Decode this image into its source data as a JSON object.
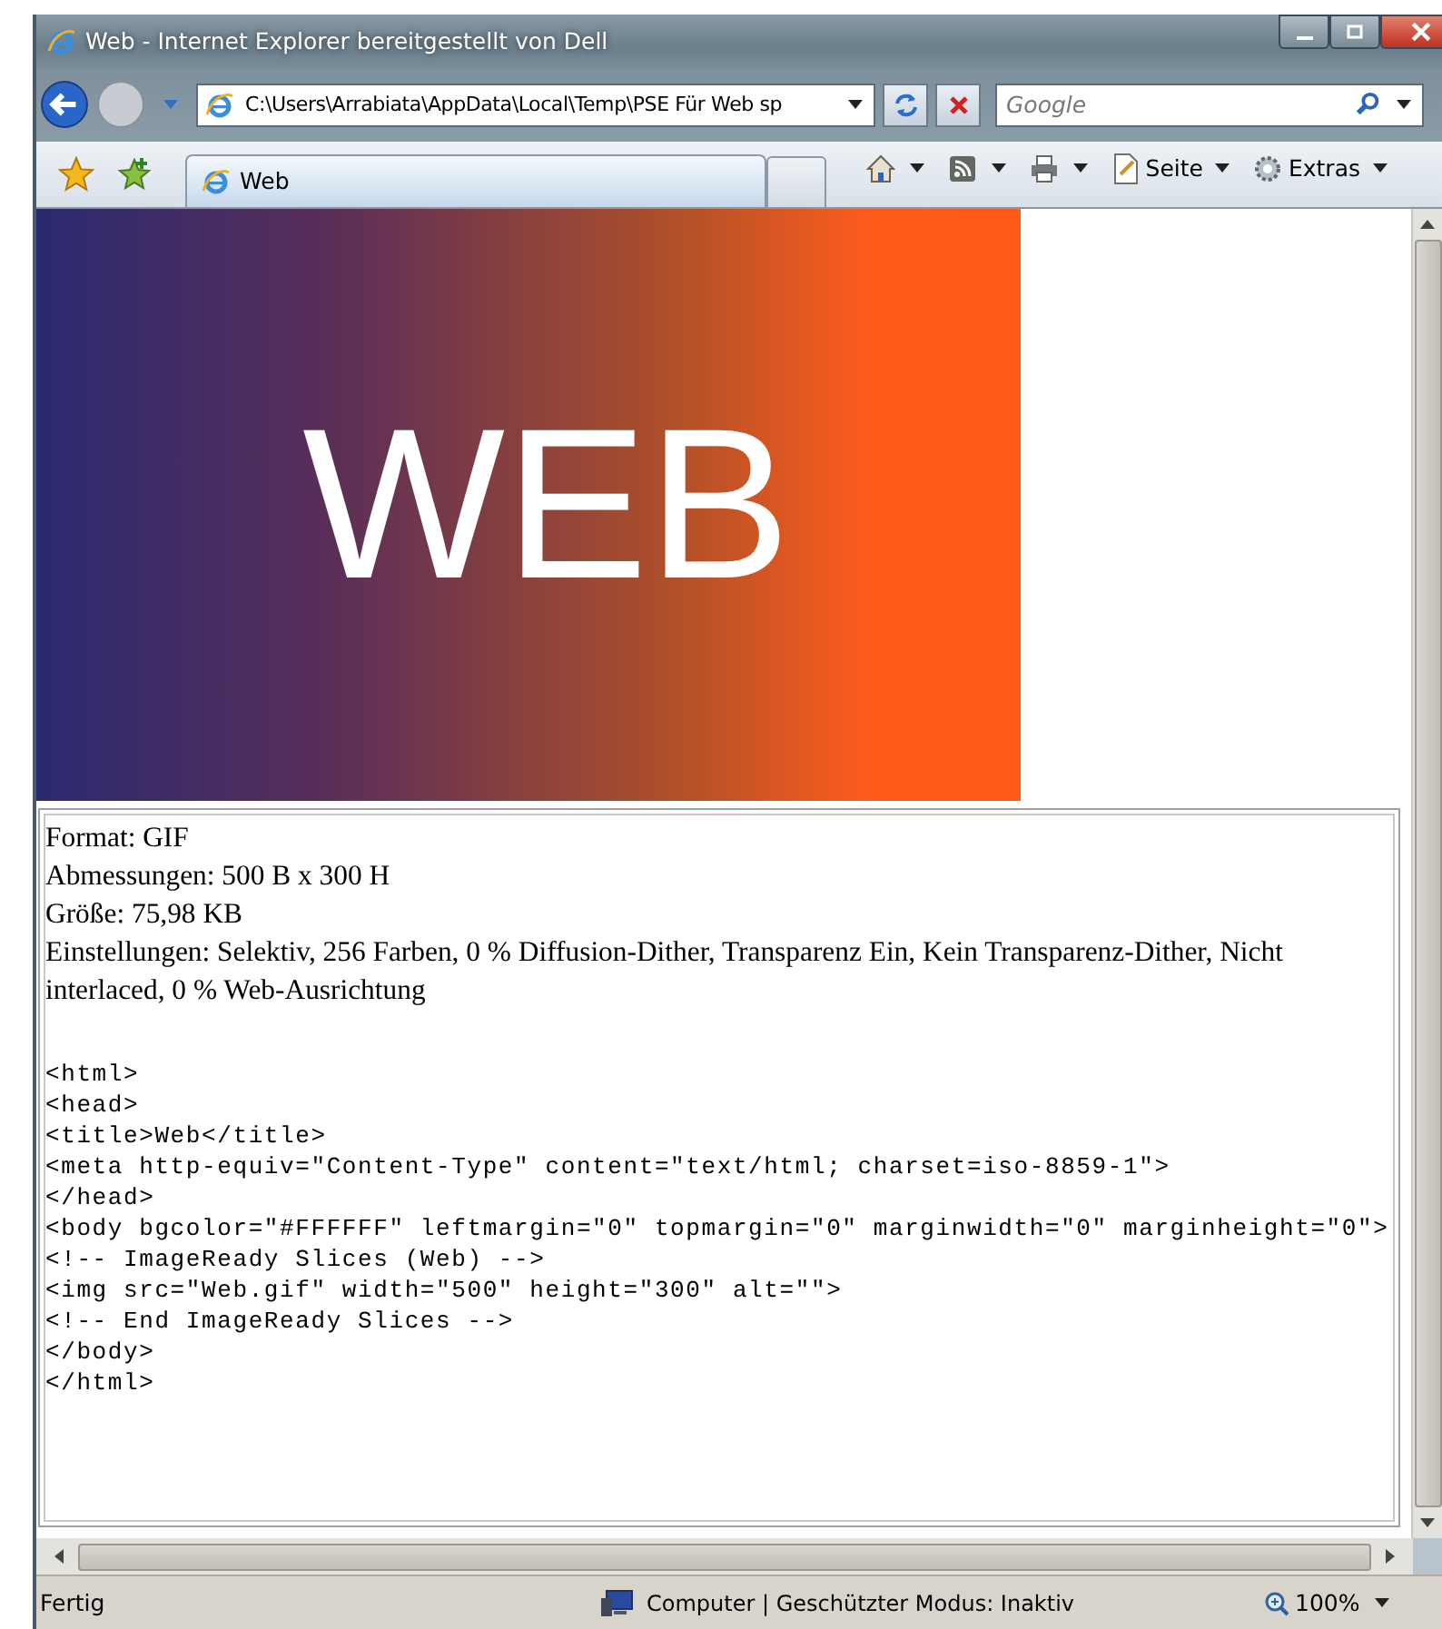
{
  "window": {
    "title": "Web - Internet Explorer bereitgestellt von Dell"
  },
  "address_bar": {
    "value": "C:\\Users\\Arrabiata\\AppData\\Local\\Temp\\PSE Für Web sp"
  },
  "search": {
    "placeholder": "Google"
  },
  "tabs": [
    {
      "label": "Web",
      "selected": true
    }
  ],
  "command_bar": [
    {
      "kind": "home"
    },
    {
      "kind": "feed"
    },
    {
      "kind": "print"
    },
    {
      "kind": "page",
      "label": "Seite"
    },
    {
      "kind": "tools",
      "label": "Extras"
    }
  ],
  "page": {
    "banner_text": "WEB",
    "info_lines": [
      "Format: GIF",
      "Abmessungen: 500 B x 300 H",
      "Größe: 75,98 KB",
      "Einstellungen: Selektiv, 256 Farben, 0 % Diffusion-Dither, Transparenz Ein, Kein Transparenz-Dither, Nicht interlaced, 0 % Web-Ausrichtung"
    ],
    "code_lines": [
      "<html>",
      "<head>",
      "<title>Web</title>",
      "<meta http-equiv=\"Content-Type\" content=\"text/html; charset=iso-8859-1\">",
      "</head>",
      "<body bgcolor=\"#FFFFFF\" leftmargin=\"0\" topmargin=\"0\" marginwidth=\"0\" marginheight=\"0\">",
      "<!-- ImageReady Slices (Web) -->",
      "<img src=\"Web.gif\" width=\"500\" height=\"300\" alt=\"\">",
      "<!-- End ImageReady Slices -->",
      "</body>",
      "</html>"
    ]
  },
  "status_bar": {
    "text": "Fertig",
    "zone": "Computer | Geschützter Modus: Inaktiv",
    "zoom": "100%"
  }
}
